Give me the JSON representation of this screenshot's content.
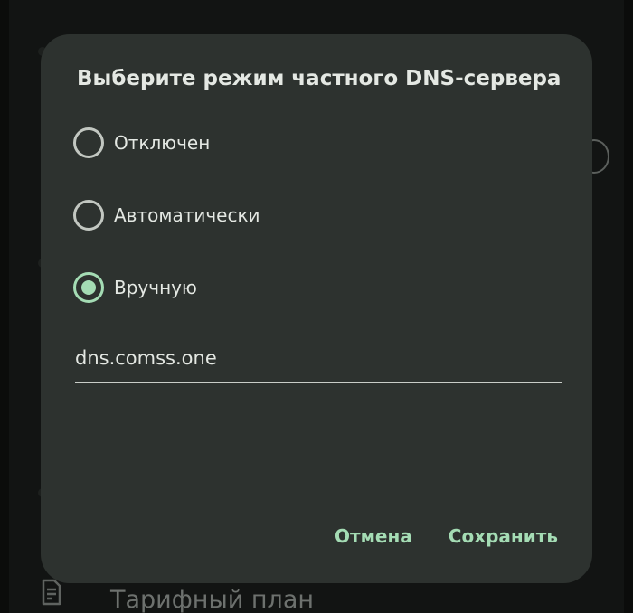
{
  "dialog": {
    "title": "Выберите режим частного DNS-сервера",
    "options": [
      {
        "label": "Отключен",
        "selected": false
      },
      {
        "label": "Автоматически",
        "selected": false
      },
      {
        "label": "Вручную",
        "selected": true
      }
    ],
    "hostname_value": "dns.comss.one",
    "cancel_label": "Отмена",
    "save_label": "Сохранить"
  },
  "background": {
    "tariff_label": "Тарифный план",
    "tariff_icon": "document-icon"
  },
  "colors": {
    "accent": "#a4dcb4",
    "dialog_bg": "#2d322f",
    "text": "#e4e8e3"
  }
}
